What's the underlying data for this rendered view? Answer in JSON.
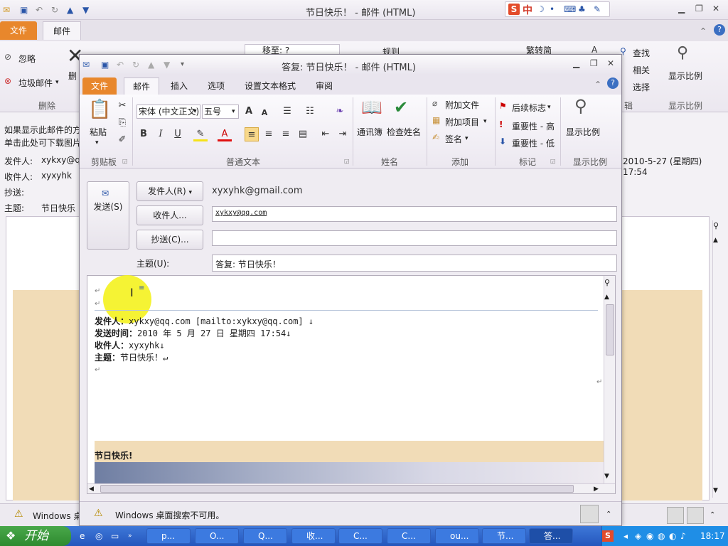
{
  "bg_window": {
    "title": "节日快乐！ - 邮件 (HTML)",
    "tab_file": "文件",
    "tab_mail": "邮件",
    "ignore_label": "忽略",
    "junk_label": "垃圾邮件",
    "delete_label": "删",
    "group_delete": "删除",
    "move_label": "移至: ?",
    "rules_label": "规则",
    "convert_label": "繁转简",
    "find_label": "查找",
    "related_label": "相关",
    "select_label": "选择",
    "zoom_label": "显示比例",
    "group_edit": "辑",
    "group_zoom": "显示比例",
    "info_line1": "如果显示此邮件的方",
    "info_line2": "单击此处可下载图片",
    "from_label": "发件人:",
    "from_value": "xykxy@q",
    "to_label": "收件人:",
    "to_value": "xyxyhk",
    "cc_label": "抄送:",
    "subject_label": "主题:",
    "subject_value": "节日快乐",
    "sent_time": "2010-5-27 (星期四) 17:54",
    "status_text": "Windows 桌"
  },
  "ime_bar": {
    "zh_label": "中"
  },
  "window": {
    "title": "答复: 节日快乐！ - 邮件 (HTML)",
    "tabs": [
      "文件",
      "邮件",
      "插入",
      "选项",
      "设置文本格式",
      "审阅"
    ],
    "ribbon": {
      "paste": "粘贴",
      "group_clipboard": "剪贴板",
      "font_name": "宋体 (中文正文)",
      "font_size": "五号",
      "group_basic_text": "普通文本",
      "address_book": "通讯簿",
      "check_names": "检查姓名",
      "group_names": "姓名",
      "attach_file": "附加文件",
      "attach_item": "附加项目",
      "signature": "签名",
      "group_include": "添加",
      "follow_up": "后续标志",
      "importance_high": "重要性 - 高",
      "importance_low": "重要性 - 低",
      "group_tags": "标记",
      "zoom": "显示比例",
      "group_zoom": "显示比例"
    },
    "header": {
      "send": "发送(S)",
      "from_button": "发件人(R)",
      "from_value": "xyxyhk@gmail.com",
      "to_button": "收件人...",
      "to_value": "xykxy@qq.com",
      "cc_button": "抄送(C)...",
      "cc_value": "",
      "subject_label": "主题(U):",
      "subject_value": "答复: 节日快乐！"
    },
    "body": {
      "orig_from_label": "发件人：",
      "orig_from_value": "xykxy@qq.com [mailto:xykxy@qq.com] ↓",
      "orig_sent_label": "发送时间：",
      "orig_sent_value": "2010 年 5 月 27 日 星期四 17:54↓",
      "orig_to_label": "收件人：",
      "orig_to_value": "xyxyhk↓",
      "orig_subject_label": "主题：",
      "orig_subject_value": "节日快乐！↵",
      "greeting": "节日快乐!"
    },
    "status_text": "Windows 桌面搜索不可用。"
  },
  "taskbar": {
    "start": "开始",
    "items": [
      "p...",
      "O...",
      "Q...",
      "收...",
      "C...",
      "C...",
      "ou...",
      "节...",
      "答..."
    ],
    "clock": "18:17"
  }
}
